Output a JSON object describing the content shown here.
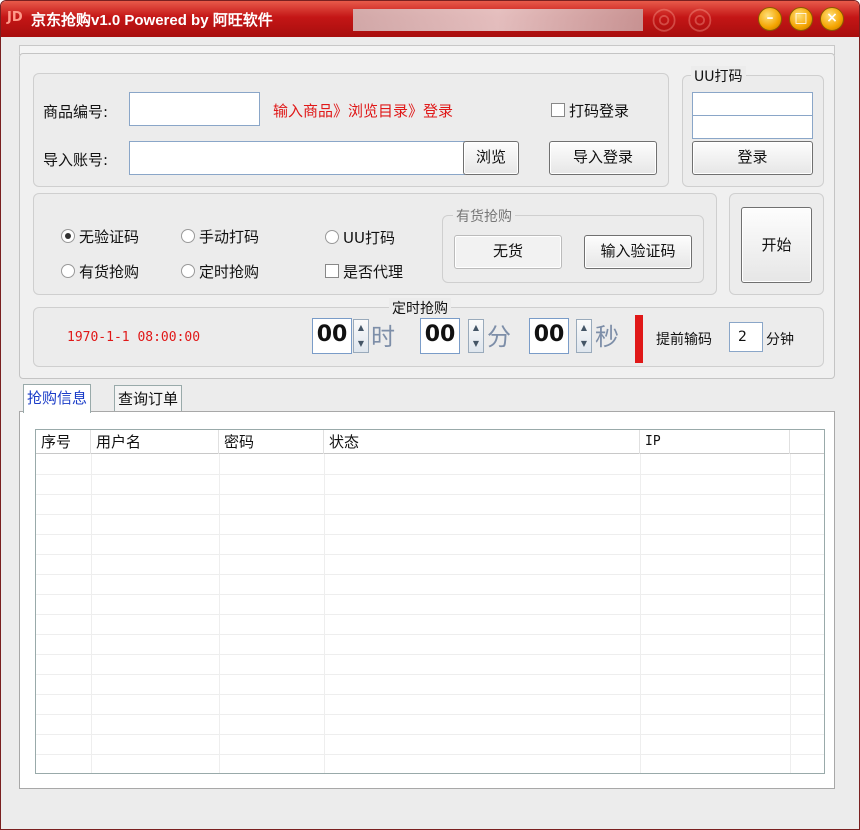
{
  "window": {
    "title": "京东抢购v1.0 Powered by 阿旺软件",
    "icon_label": "JD",
    "controls": {
      "minimize": "–",
      "maximize": "□",
      "close": "×"
    }
  },
  "product_row": {
    "label": "商品编号:",
    "value": "",
    "hint": "输入商品》浏览目录》登录",
    "captcha_login_checkbox": "打码登录",
    "captcha_login_checked": false
  },
  "account_row": {
    "label": "导入账号:",
    "value": "",
    "browse_button": "浏览",
    "import_login_button": "导入登录"
  },
  "uu_group": {
    "legend": "UU打码",
    "user_value": "",
    "pass_value": "",
    "login_button": "登录"
  },
  "captcha_mode": {
    "options": [
      {
        "label": "无验证码",
        "checked": true
      },
      {
        "label": "手动打码",
        "checked": false
      },
      {
        "label": "UU打码",
        "checked": false
      },
      {
        "label": "有货抢购",
        "checked": false
      },
      {
        "label": "定时抢购",
        "checked": false
      }
    ],
    "proxy_checkbox": "是否代理",
    "proxy_checked": false
  },
  "in_stock_group": {
    "legend": "有货抢购",
    "status": "无货",
    "enter_captcha_button": "输入验证码"
  },
  "start_button": "开始",
  "timer": {
    "legend": "定时抢购",
    "clock": "1970-1-1 08:00:00",
    "hours": "00",
    "hours_unit": "时",
    "minutes": "00",
    "minutes_unit": "分",
    "seconds": "00",
    "seconds_unit": "秒",
    "advance_label": "提前输码",
    "advance_value": "2",
    "advance_unit": "分钟"
  },
  "tabs": [
    {
      "label": "抢购信息",
      "active": true
    },
    {
      "label": "查询订单",
      "active": false
    }
  ],
  "table": {
    "columns": [
      "序号",
      "用户名",
      "密码",
      "状态",
      "IP"
    ],
    "rows": []
  },
  "colors": {
    "title_red": "#c41616",
    "accent_red": "#e01818",
    "tab_blue": "#1a3cc8"
  }
}
